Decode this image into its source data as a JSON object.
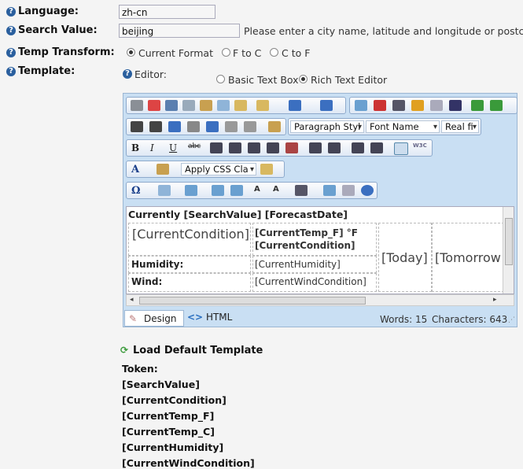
{
  "form": {
    "language_label": "Language:",
    "language_value": "zh-cn",
    "search_label": "Search Value:",
    "search_value": "beijing",
    "search_hint": "Please enter a city name, latitude and longitude or postc",
    "temp_label": "Temp Transform:",
    "temp_options": [
      "Current Format",
      "F to C",
      "C to F"
    ],
    "template_label": "Template:",
    "editor_label": "Editor:",
    "editor_options": [
      "Basic Text Box",
      "Rich Text Editor"
    ]
  },
  "toolbar": {
    "paragraph_style": "Paragraph Styl",
    "font_name": "Font Name",
    "font_size": "Real fi",
    "css_class": "Apply CSS Cla"
  },
  "template_content": {
    "header": "Currently [SearchValue] [ForecastDate]",
    "current_condition": "[CurrentCondition]",
    "temp_f": "[CurrentTemp_F] °F",
    "condition_small": "[CurrentCondition]",
    "humidity_label": "Humidity:",
    "humidity_token": "[CurrentHumidity]",
    "wind_label": "Wind:",
    "wind_token": "[CurrentWindCondition]",
    "today": "[Today]",
    "tomorrow": "[Tomorrow"
  },
  "status": {
    "design_tab": "Design",
    "html_tab": "HTML",
    "words": "Words: 15",
    "characters": "Characters: 643"
  },
  "load_default": "Load Default Template",
  "tokens_label": "Token:",
  "tokens": [
    "[SearchValue]",
    "[CurrentCondition]",
    "[CurrentTemp_F]",
    "[CurrentTemp_C]",
    "[CurrentHumidity]",
    "[CurrentWindCondition]"
  ]
}
